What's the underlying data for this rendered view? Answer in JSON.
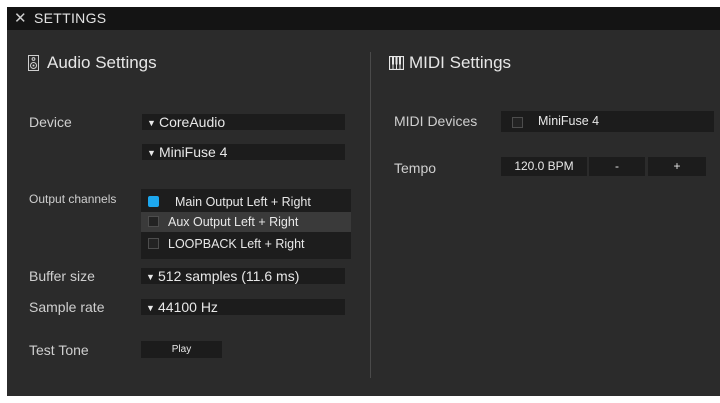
{
  "window": {
    "title": "SETTINGS",
    "close_glyph": "✕"
  },
  "audio": {
    "title": "Audio Settings",
    "icon": "speaker-icon",
    "device_label": "Device",
    "device_value": "CoreAudio",
    "subdevice_value": "MiniFuse 4",
    "output_label": "Output channels",
    "channels": [
      {
        "label": "Main Output Left + Right",
        "checked": true
      },
      {
        "label": "Aux Output Left + Right",
        "checked": false
      },
      {
        "label": "LOOPBACK Left + Right",
        "checked": false
      }
    ],
    "buffer_label": "Buffer size",
    "buffer_value": "512 samples (11.6 ms)",
    "rate_label": "Sample rate",
    "rate_value": "44100 Hz",
    "test_label": "Test Tone",
    "play_label": "Play"
  },
  "midi": {
    "title": "MIDI Settings",
    "icon": "piano-keys-icon",
    "devices_label": "MIDI Devices",
    "device_name": "MiniFuse 4",
    "device_checked": false,
    "tempo_label": "Tempo",
    "tempo_value": "120.0 BPM",
    "minus_label": "-",
    "plus_label": "+"
  },
  "colors": {
    "panel_bg": "#2b2b2b",
    "titlebar_bg": "#141414",
    "field_bg": "#1c1c1c",
    "accent": "#1da7ee"
  }
}
